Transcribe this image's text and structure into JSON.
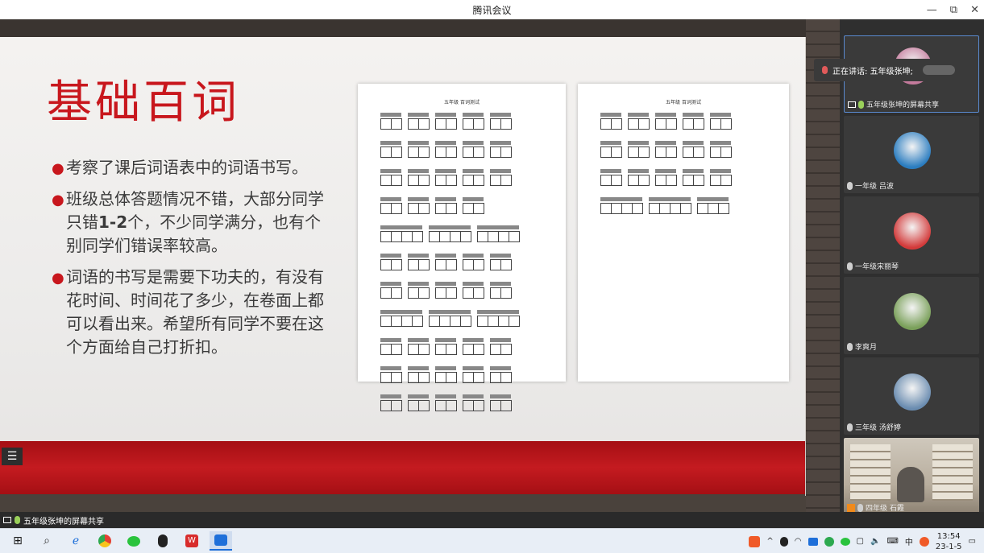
{
  "window": {
    "title": "腾讯会议",
    "minimize": "—",
    "restore": "⧉",
    "close": "✕"
  },
  "slide": {
    "title": "基础百词",
    "bullets": [
      {
        "text": "考察了课后词语表中的词语书写。"
      },
      {
        "pre": "班级总体答题情况不错，大部分同学只错",
        "bold": "1-2",
        "post": "个，不少同学满分，也有个别同学们错误率较高。"
      },
      {
        "text": "词语的书写是需要下功夫的，有没有花时间、时间花了多少，在卷面上都可以看出来。希望所有同学不要在这个方面给自己打折扣。"
      }
    ],
    "paper_left_heading": "五年级  百词测试",
    "paper_right_heading": "五年级  百词测试"
  },
  "speaking": {
    "text": "正在讲话: 五年级张坤;"
  },
  "participants": [
    {
      "name": "五年级张坤的屏幕共享",
      "avatar_color": "#c47a9c"
    },
    {
      "name": "一年级 吕波",
      "avatar_color": "#2b7dc0"
    },
    {
      "name": "一年级宋丽琴",
      "avatar_color": "#d33a3a"
    },
    {
      "name": "李爽月",
      "avatar_color": "#7aa05a"
    },
    {
      "name": "三年级 汤舒婷",
      "avatar_color": "#6a8cb0"
    },
    {
      "name": "四年级  石霞",
      "avatar_color": "#8a7a6a"
    }
  ],
  "status_strip": {
    "label": "五年级张坤的屏幕共享"
  },
  "taskbar": {
    "ime": "中",
    "time": "13:54",
    "date": "23-1-5"
  }
}
